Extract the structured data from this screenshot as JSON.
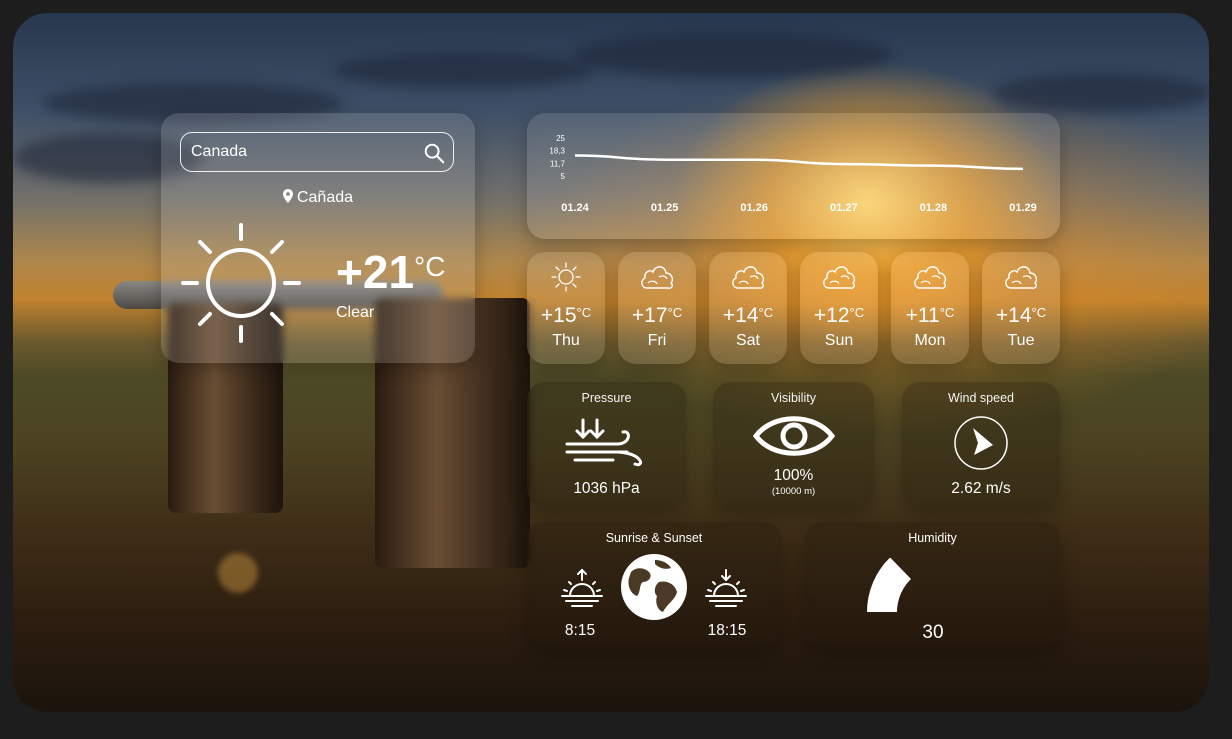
{
  "search": {
    "value": "Canada",
    "button_icon": "search-icon"
  },
  "location": {
    "icon": "map-pin-icon",
    "name": "Cañada"
  },
  "current": {
    "icon": "sun-icon",
    "temp": "+21",
    "unit": "°C",
    "condition": "Clear"
  },
  "chart_data": {
    "type": "line",
    "x": [
      "01.24",
      "01.25",
      "01.26",
      "01.27",
      "01.28",
      "01.29"
    ],
    "series": [
      {
        "values": [
          20.5,
          18.3,
          18.3,
          16.0,
          15.2,
          13.5
        ]
      }
    ],
    "y_ticks": [
      "25",
      "18,3",
      "11,7",
      "5"
    ],
    "ylim": [
      5,
      25
    ],
    "grid": false
  },
  "forecast": [
    {
      "icon": "sun-icon",
      "temp": "+15",
      "unit": "°C",
      "day": "Thu"
    },
    {
      "icon": "cloud-icon",
      "temp": "+17",
      "unit": "°C",
      "day": "Fri"
    },
    {
      "icon": "cloud-icon",
      "temp": "+14",
      "unit": "°C",
      "day": "Sat"
    },
    {
      "icon": "cloud-icon",
      "temp": "+12",
      "unit": "°C",
      "day": "Sun"
    },
    {
      "icon": "cloud-icon",
      "temp": "+11",
      "unit": "°C",
      "day": "Mon"
    },
    {
      "icon": "cloud-icon",
      "temp": "+14",
      "unit": "°C",
      "day": "Tue"
    }
  ],
  "pressure": {
    "title": "Pressure",
    "icon": "pressure-wind-icon",
    "value": "1036 hPa"
  },
  "visibility": {
    "title": "Visibility",
    "icon": "eye-icon",
    "value": "100%",
    "detail": "(10000 m)"
  },
  "wind": {
    "title": "Wind speed",
    "icon": "wind-direction-icon",
    "value": "2.62 m/s"
  },
  "sun_times": {
    "title": "Sunrise & Sunset",
    "sunrise_icon": "sunrise-icon",
    "sunrise": "8:15",
    "globe_icon": "globe-icon",
    "sunset_icon": "sunset-icon",
    "sunset": "18:15"
  },
  "humidity": {
    "title": "Humidity",
    "value": "30",
    "fraction": 0.3
  }
}
